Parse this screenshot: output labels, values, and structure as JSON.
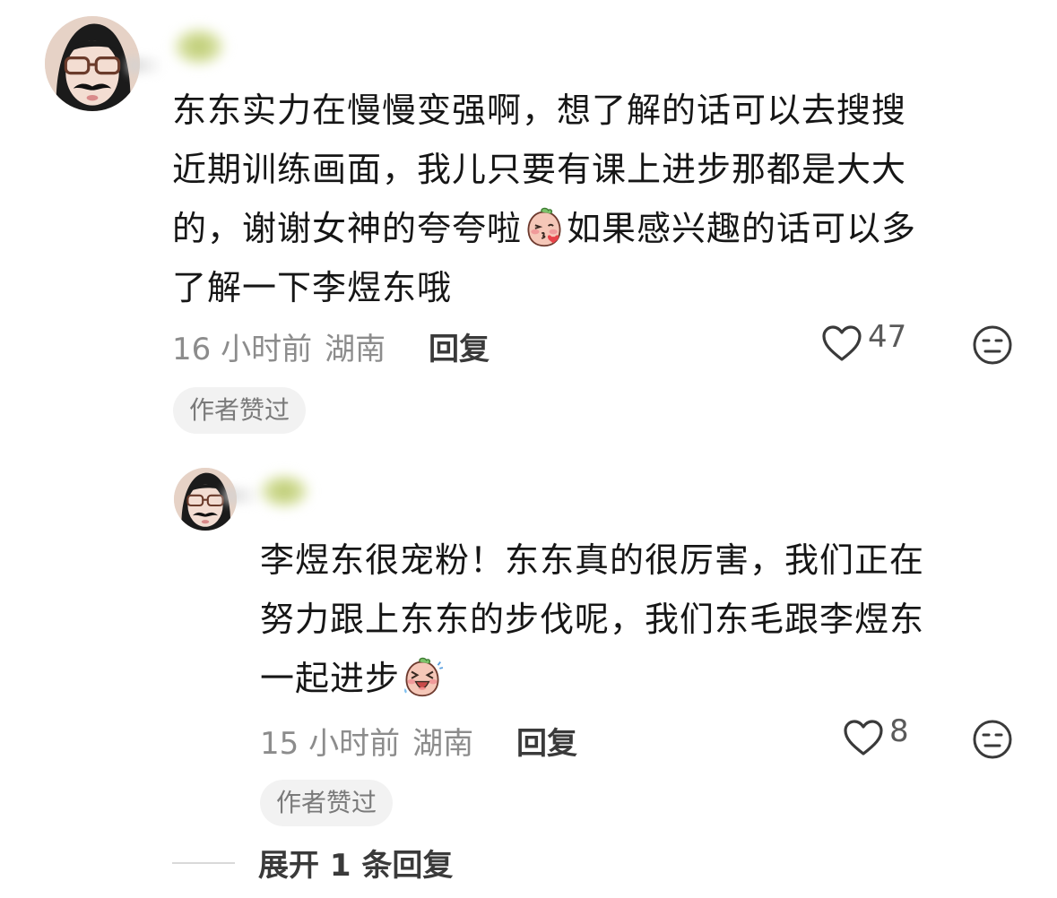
{
  "comments": [
    {
      "lines": [
        "东东实力在慢慢变强啊，想了解的话可以去搜搜",
        "近期训练画面，我儿只要有课上进步那都是大大",
        "的，谢谢女神的夸夸啦",
        "了解一下李煜东哦"
      ],
      "line3_suffix": "如果感兴趣的话可以多",
      "emoji": "blushing-kiss-emoji",
      "time": "16 小时前",
      "location": "湖南",
      "reply_label": "回复",
      "like_count": "47",
      "badge": "作者赞过"
    },
    {
      "lines": [
        "李煜东很宠粉！东东真的很厉害，我们正在",
        "努力跟上东东的步伐呢，我们东毛跟李煜东",
        "一起进步"
      ],
      "emoji": "laughing-emoji",
      "time": "15 小时前",
      "location": "湖南",
      "reply_label": "回复",
      "like_count": "8",
      "badge": "作者赞过"
    }
  ],
  "expand_label": "展开 1 条回复",
  "icons": {
    "like": "heart-outline-icon",
    "dislike": "neutral-face-icon"
  },
  "colors": {
    "text": "#161616",
    "meta": "#8c8c8c",
    "badge_bg": "#f2f2f2"
  }
}
